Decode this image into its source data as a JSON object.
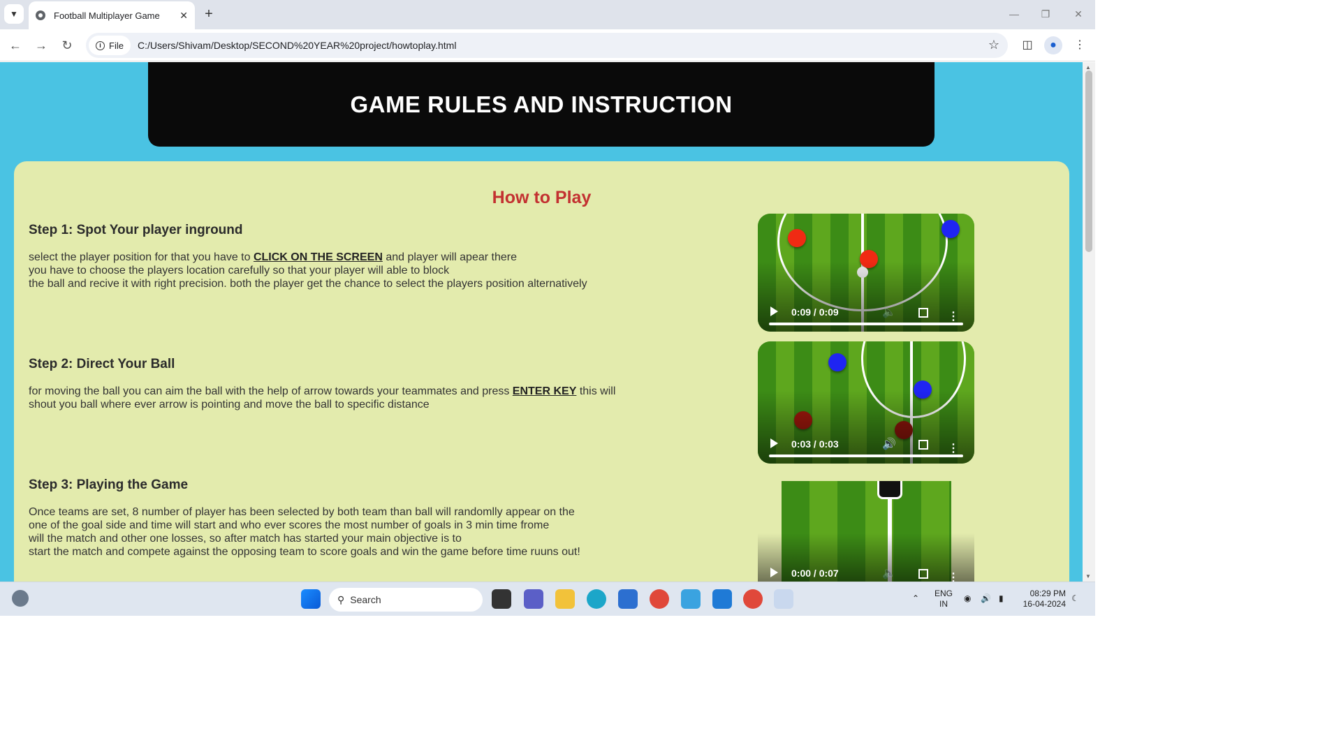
{
  "browser": {
    "tab_title": "Football Multiplayer Game",
    "new_tab": "+",
    "address_chip": "File",
    "url": "C:/Users/Shivam/Desktop/SECOND%20YEAR%20project/howtoplay.html"
  },
  "page": {
    "header_title": "GAME RULES AND INSTRUCTION",
    "section_heading": "How to Play",
    "steps": [
      {
        "title": "Step 1: Spot Your player inground",
        "line1_pre": "select the player position for that you have to ",
        "line1_em": "CLICK ON THE SCREEN",
        "line1_post": " and player will apear there",
        "line2": "you have to choose the players location carefully so that your player will able to block",
        "line3": "the ball and recive it with right precision. both the player get the chance to select the players position alternatively",
        "video_time": "0:09 / 0:09"
      },
      {
        "title": "Step 2: Direct Your Ball",
        "line1_pre": "for moving the ball you can aim the ball with the help of arrow towards your teammates and press ",
        "line1_em": "ENTER KEY",
        "line1_post": " this will",
        "line2": "shout you ball where ever arrow is pointing and move the ball to specific distance",
        "video_time": "0:03 / 0:03"
      },
      {
        "title": "Step 3: Playing the Game",
        "line1": "Once teams are set, 8 number of player has been selected by both team than ball will randomlly appear on the",
        "line2": "one of the goal side and time will start and who ever scores the most number of goals in 3 min time frome",
        "line3": "will the match and other one losses, so after match has started your main objective is to",
        "line4": "start the match and compete against the opposing team to score goals and win the game before time ruuns out!",
        "video_time": "0:00 / 0:07"
      }
    ]
  },
  "taskbar": {
    "search_label": "Search",
    "lang_line1": "ENG",
    "lang_line2": "IN",
    "time": "08:29 PM",
    "date": "16-04-2024"
  },
  "colors": {
    "page_bg": "#4ac3e3",
    "card_bg": "#e3ebad",
    "heading_red": "#c33131"
  }
}
